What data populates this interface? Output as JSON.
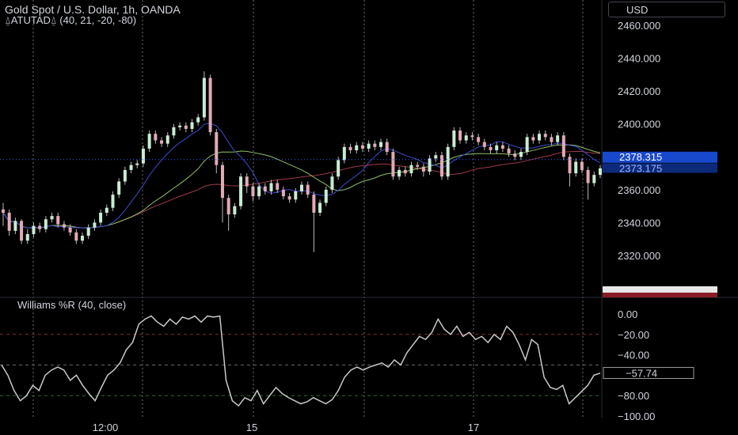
{
  "header": {
    "title": "Gold Spot / U.S. Dollar, 1h, OANDA",
    "indicator": "⍙ATUTAD⍙ (40, 21, -20, -80)",
    "currency": "USD"
  },
  "colors": {
    "up": "#c8ecd2",
    "down": "#e2aab5",
    "wick": "#b9b9b9",
    "ma_blue": "#3f4bcf",
    "ma_red": "#a03a4b",
    "ma_green": "#8fbf6a",
    "price_tag": "#1848cc",
    "grid": "#6f6f6f",
    "wr_line": "#c9c9c9"
  },
  "chart_data": [
    {
      "type": "candlestick",
      "title": "Gold Spot / U.S. Dollar, 1h, OANDA",
      "ylim": [
        2310,
        2470
      ],
      "yticks": [
        "2460.000",
        "2440.000",
        "2420.000",
        "2400.000",
        "2380.000",
        "2360.000",
        "2340.000",
        "2320.000"
      ],
      "last_price": "2378.315",
      "second_price": "2373.175",
      "xticks": [
        "12:00",
        "15",
        "17"
      ],
      "candles": [
        [
          2348,
          2346,
          2352,
          2338
        ],
        [
          2346,
          2335,
          2348,
          2332
        ],
        [
          2335,
          2341,
          2343,
          2333
        ],
        [
          2341,
          2329,
          2342,
          2327
        ],
        [
          2329,
          2333,
          2336,
          2327
        ],
        [
          2333,
          2338,
          2340,
          2331
        ],
        [
          2338,
          2336,
          2340,
          2334
        ],
        [
          2336,
          2342,
          2344,
          2334
        ],
        [
          2342,
          2344,
          2346,
          2340
        ],
        [
          2344,
          2339,
          2346,
          2337
        ],
        [
          2339,
          2337,
          2341,
          2335
        ],
        [
          2337,
          2334,
          2339,
          2332
        ],
        [
          2334,
          2329,
          2336,
          2327
        ],
        [
          2329,
          2332,
          2334,
          2327
        ],
        [
          2332,
          2337,
          2339,
          2330
        ],
        [
          2337,
          2340,
          2342,
          2335
        ],
        [
          2340,
          2346,
          2348,
          2338
        ],
        [
          2346,
          2349,
          2351,
          2344
        ],
        [
          2349,
          2357,
          2359,
          2347
        ],
        [
          2357,
          2365,
          2367,
          2355
        ],
        [
          2365,
          2372,
          2374,
          2363
        ],
        [
          2372,
          2375,
          2377,
          2370
        ],
        [
          2375,
          2376,
          2378,
          2373
        ],
        [
          2376,
          2385,
          2387,
          2374
        ],
        [
          2385,
          2394,
          2396,
          2383
        ],
        [
          2394,
          2390,
          2396,
          2388
        ],
        [
          2390,
          2388,
          2392,
          2386
        ],
        [
          2388,
          2393,
          2395,
          2386
        ],
        [
          2393,
          2398,
          2400,
          2391
        ],
        [
          2398,
          2399,
          2401,
          2396
        ],
        [
          2399,
          2397,
          2401,
          2395
        ],
        [
          2397,
          2401,
          2403,
          2395
        ],
        [
          2401,
          2404,
          2406,
          2399
        ],
        [
          2404,
          2428,
          2432,
          2402
        ],
        [
          2428,
          2395,
          2430,
          2393
        ],
        [
          2395,
          2375,
          2397,
          2370
        ],
        [
          2375,
          2355,
          2377,
          2340
        ],
        [
          2355,
          2345,
          2357,
          2335
        ],
        [
          2345,
          2350,
          2352,
          2343
        ],
        [
          2350,
          2368,
          2370,
          2348
        ],
        [
          2368,
          2362,
          2370,
          2358
        ],
        [
          2362,
          2356,
          2364,
          2353
        ],
        [
          2356,
          2362,
          2364,
          2354
        ],
        [
          2362,
          2359,
          2364,
          2357
        ],
        [
          2359,
          2364,
          2366,
          2357
        ],
        [
          2364,
          2360,
          2366,
          2358
        ],
        [
          2360,
          2356,
          2362,
          2354
        ],
        [
          2356,
          2354,
          2358,
          2352
        ],
        [
          2354,
          2359,
          2361,
          2352
        ],
        [
          2359,
          2363,
          2365,
          2357
        ],
        [
          2363,
          2357,
          2365,
          2355
        ],
        [
          2357,
          2346,
          2359,
          2322
        ],
        [
          2346,
          2352,
          2354,
          2344
        ],
        [
          2352,
          2360,
          2362,
          2350
        ],
        [
          2360,
          2368,
          2370,
          2358
        ],
        [
          2368,
          2378,
          2380,
          2366
        ],
        [
          2378,
          2386,
          2388,
          2376
        ],
        [
          2386,
          2384,
          2388,
          2382
        ],
        [
          2384,
          2387,
          2389,
          2382
        ],
        [
          2387,
          2385,
          2389,
          2383
        ],
        [
          2385,
          2388,
          2390,
          2383
        ],
        [
          2388,
          2386,
          2390,
          2384
        ],
        [
          2386,
          2389,
          2391,
          2384
        ],
        [
          2389,
          2383,
          2391,
          2381
        ],
        [
          2383,
          2368,
          2385,
          2366
        ],
        [
          2368,
          2372,
          2374,
          2366
        ],
        [
          2372,
          2370,
          2374,
          2368
        ],
        [
          2370,
          2375,
          2377,
          2368
        ],
        [
          2375,
          2374,
          2377,
          2372
        ],
        [
          2374,
          2371,
          2376,
          2368
        ],
        [
          2371,
          2379,
          2381,
          2369
        ],
        [
          2379,
          2381,
          2383,
          2377
        ],
        [
          2381,
          2368,
          2383,
          2366
        ],
        [
          2368,
          2386,
          2388,
          2366
        ],
        [
          2386,
          2396,
          2398,
          2384
        ],
        [
          2396,
          2390,
          2398,
          2388
        ],
        [
          2390,
          2393,
          2395,
          2388
        ],
        [
          2393,
          2392,
          2395,
          2390
        ],
        [
          2392,
          2389,
          2394,
          2387
        ],
        [
          2389,
          2386,
          2391,
          2384
        ],
        [
          2386,
          2384,
          2388,
          2382
        ],
        [
          2384,
          2387,
          2389,
          2382
        ],
        [
          2387,
          2385,
          2389,
          2383
        ],
        [
          2385,
          2382,
          2387,
          2380
        ],
        [
          2382,
          2380,
          2384,
          2378
        ],
        [
          2380,
          2383,
          2385,
          2378
        ],
        [
          2383,
          2392,
          2394,
          2381
        ],
        [
          2392,
          2390,
          2394,
          2388
        ],
        [
          2390,
          2394,
          2396,
          2388
        ],
        [
          2394,
          2392,
          2396,
          2390
        ],
        [
          2392,
          2389,
          2394,
          2387
        ],
        [
          2389,
          2393,
          2395,
          2387
        ],
        [
          2393,
          2380,
          2395,
          2378
        ],
        [
          2380,
          2370,
          2382,
          2362
        ],
        [
          2370,
          2377,
          2379,
          2368
        ],
        [
          2377,
          2372,
          2379,
          2370
        ],
        [
          2372,
          2364,
          2374,
          2354
        ],
        [
          2364,
          2369,
          2371,
          2362
        ],
        [
          2369,
          2373,
          2375,
          2367
        ]
      ]
    },
    {
      "type": "line",
      "title": "Williams %R (40, close)",
      "ylim": [
        -100,
        0
      ],
      "yticks": [
        "0.00",
        "−20.00",
        "−40.00",
        "−80.00",
        "−100.00"
      ],
      "levels": [
        -20,
        -50,
        -80
      ],
      "last_value": "−57.74",
      "values": [
        -50,
        -60,
        -75,
        -85,
        -80,
        -70,
        -75,
        -60,
        -55,
        -52,
        -55,
        -65,
        -60,
        -70,
        -78,
        -85,
        -72,
        -60,
        -55,
        -48,
        -35,
        -28,
        -10,
        -5,
        -2,
        -8,
        -12,
        -5,
        -10,
        -3,
        -5,
        -2,
        -8,
        -2,
        -3,
        -2,
        -65,
        -85,
        -90,
        -82,
        -85,
        -75,
        -88,
        -80,
        -72,
        -78,
        -82,
        -85,
        -88,
        -86,
        -82,
        -85,
        -88,
        -84,
        -75,
        -62,
        -55,
        -52,
        -55,
        -52,
        -50,
        -48,
        -52,
        -45,
        -50,
        -38,
        -30,
        -22,
        -25,
        -18,
        -5,
        -15,
        -20,
        -12,
        -22,
        -18,
        -25,
        -22,
        -28,
        -20,
        -25,
        -12,
        -18,
        -30,
        -45,
        -25,
        -30,
        -62,
        -72,
        -74,
        -70,
        -88,
        -82,
        -76,
        -70,
        -60,
        -58
      ]
    }
  ]
}
